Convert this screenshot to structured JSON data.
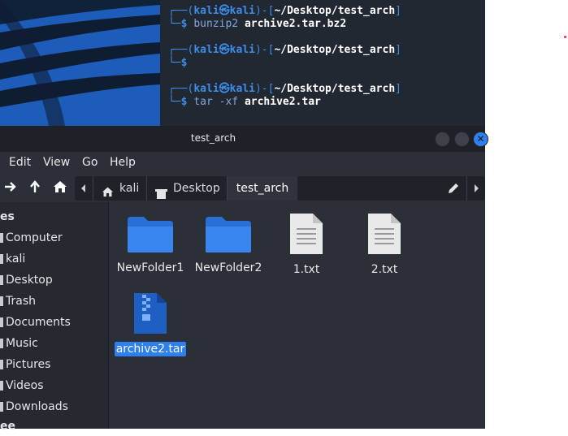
{
  "terminal": {
    "blocks": [
      {
        "user": "kali",
        "host": "kali",
        "path": "~/Desktop/test_arch",
        "command": "bunzip2",
        "args": "archive2.tar.bz2"
      },
      {
        "user": "kali",
        "host": "kali",
        "path": "~/Desktop/test_arch",
        "command": "",
        "args": ""
      },
      {
        "user": "kali",
        "host": "kali",
        "path": "~/Desktop/test_arch",
        "command": "tar -xf",
        "args": "archive2.tar"
      }
    ],
    "prompt_symbol": "$",
    "at_symbol": "㉿"
  },
  "window": {
    "title": "test_arch",
    "close_glyph": "✕"
  },
  "menubar": {
    "items": [
      "Edit",
      "View",
      "Go",
      "Help"
    ]
  },
  "toolbar": {
    "icons": [
      "arrow-right-icon",
      "arrow-up-icon",
      "home-icon"
    ],
    "path": {
      "crumbs": [
        "kali",
        "Desktop",
        "test_arch"
      ]
    }
  },
  "sidebar": {
    "header": "es",
    "items": [
      "Computer",
      "kali",
      "Desktop",
      "Trash",
      "Documents",
      "Music",
      "Pictures",
      "Videos",
      "Downloads"
    ],
    "footer": "ee"
  },
  "files": [
    {
      "name": "NewFolder1",
      "type": "folder"
    },
    {
      "name": "NewFolder2",
      "type": "folder"
    },
    {
      "name": "1.txt",
      "type": "text"
    },
    {
      "name": "2.txt",
      "type": "text"
    },
    {
      "name": "archive2.tar",
      "type": "archive",
      "selected": true
    }
  ],
  "colors": {
    "accent": "#2f80ed",
    "terminal_bg": "#212832",
    "prompt": "#3b8ee9"
  }
}
